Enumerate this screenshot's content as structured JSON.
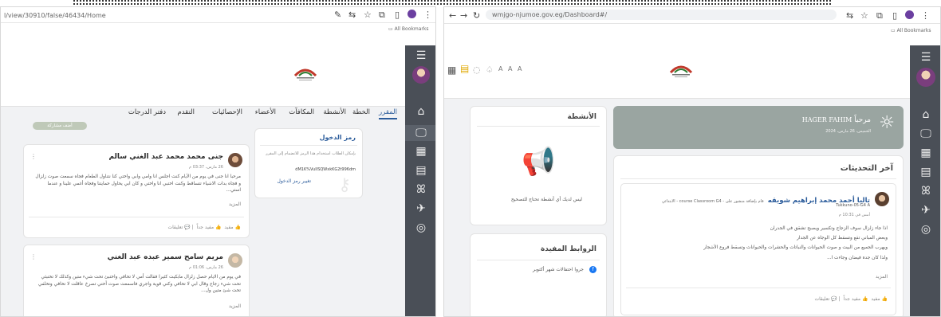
{
  "left": {
    "url": "l/view/30910/false/46434/Home",
    "bookmarks": "All Bookmarks",
    "tabs": [
      "المقرر",
      "الخطة",
      "الأنشطة",
      "المكافآت",
      "الأعضاء",
      "الإحصائيات",
      "التقدم",
      "دفتر الدرجات"
    ],
    "pill": "أضف مشاركة",
    "code_box": {
      "title": "رمز الدخول",
      "desc": "بإمكان الطلاب استخدام هذا الرمز للانضمام إلى المقرر",
      "code": "dM1K%VuIISQWxkKG2t996dm",
      "change": "تغيير رمز الدخول"
    },
    "post1": {
      "name": "جنى محمد محمد عبد الغني سالم",
      "date": "26 مارس، 03:37 م",
      "body": "مرحبا انا جنى في يوم من الأيام كنت اجلس انا وامي وابي واختي كنا نتناول الطعام فجاه سمعت صوت زلزال و فجاه بدات الاشياء تتساقط وكنت اختبي انا واختي و كان ابي يحاول حمايتنا وفجاه أغمي علينا و عندما استي...",
      "more": "المزيد",
      "actions": [
        "مفيد",
        "مفيد جداً",
        "تعليقات"
      ]
    },
    "post2": {
      "name": "مريم سامح سمير عبده عبد الغني",
      "date": "26 مارس، 01:06 م",
      "body": "في يوم من الايام حصل زلزال مابكيت كثيرا فقالت أمي لا تخافي واختبئ تحت شيء متين وكذلك لا تختبئي تحت شيء زجاج وقال ابي لا تخافي وكني قوية واجري فاسمعت صوت أختي تصرخ عاقلت لا تخافي وتخلفي تحت شئ متين ول...",
      "more": "المزيد"
    }
  },
  "right": {
    "url": "wmjgo-njumoe.gov.eg/Dashboard#/",
    "bookmarks": "All Bookmarks",
    "font_sizes": "A A A",
    "welcome": {
      "text": "مرحباً",
      "name": "HAGER FAHIM",
      "date": "الخميس، 26 مارس، 2024"
    },
    "activities": {
      "title": "الأنشطة",
      "empty": "ليس لديك أي أنشطة تحتاج للتصحيح"
    },
    "links": {
      "title": "الروابط المفيدة",
      "item": "جروا احتفالات شهر أكتوبر"
    },
    "updates": {
      "title": "آخر التحديثات",
      "poster": "تاليا أحمد محمد إبراهيم شويقه",
      "action": "قام بإضافة منشور على - course Classroom G4 - الابتدائي",
      "course": "Tukkuno-05-G4 A",
      "date": "أمس في 10:31 م",
      "lines": [
        "اذا جاء زلزال سوف الزجاج وتكسير ويصبح تشقق في الجدران",
        "وبعض المباني تقع وتسقط كل الوجاه عن الجدار",
        "ويهرب الجميع من البيت و صوت الحيوانات والنباتات والحشرات والحيوانات وتسقط فروع الأشجار",
        "ولذا كان جدة فيضان وجاءت ا..."
      ],
      "more": "المزيد",
      "actions": [
        "مفيد",
        "مفيد جداً",
        "تعليقات"
      ]
    }
  }
}
